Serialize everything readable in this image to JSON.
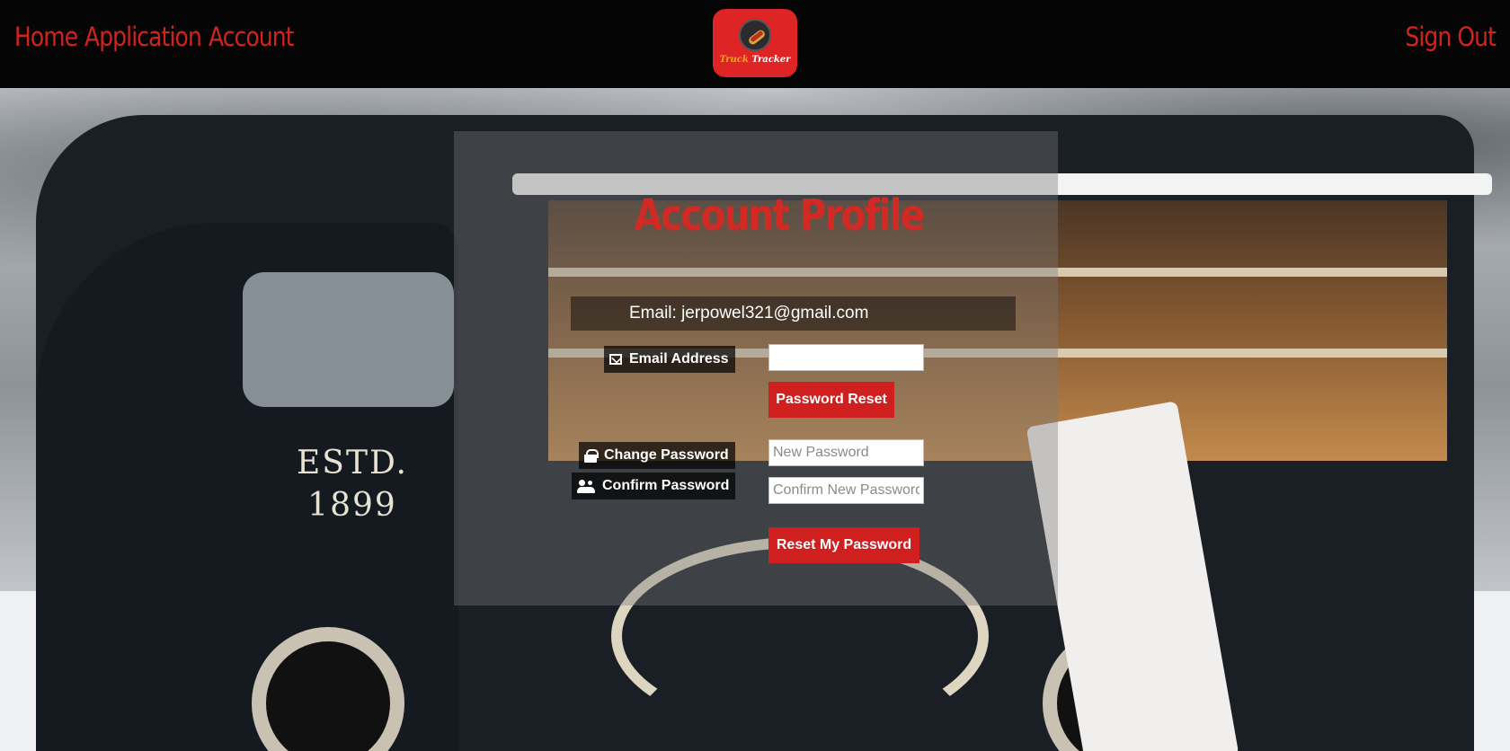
{
  "nav": {
    "home": "Home",
    "application": "Application",
    "account": "Account",
    "sign_out": "Sign Out"
  },
  "logo": {
    "icon": "hotdog-icon",
    "word1": "Truck",
    "word2": "Tracker"
  },
  "profile": {
    "title": "Account Profile",
    "email_line": "Email: jerpowel321@gmail.com",
    "email_label": "Email Address",
    "email_value": "",
    "password_reset_button": "Password Reset",
    "change_password_label": "Change Password",
    "new_password_placeholder": "New Password",
    "confirm_password_label": "Confirm Password",
    "confirm_password_placeholder": "Confirm New Password",
    "reset_my_password_button": "Reset My Password"
  },
  "colors": {
    "accent": "#d12a24",
    "navbar_bg": "#050505",
    "button_bg": "#cf1f1f",
    "label_bg": "#000000"
  },
  "icons": {
    "email": "envelope-icon",
    "change_password": "lock-icon",
    "confirm_password": "users-icon"
  }
}
